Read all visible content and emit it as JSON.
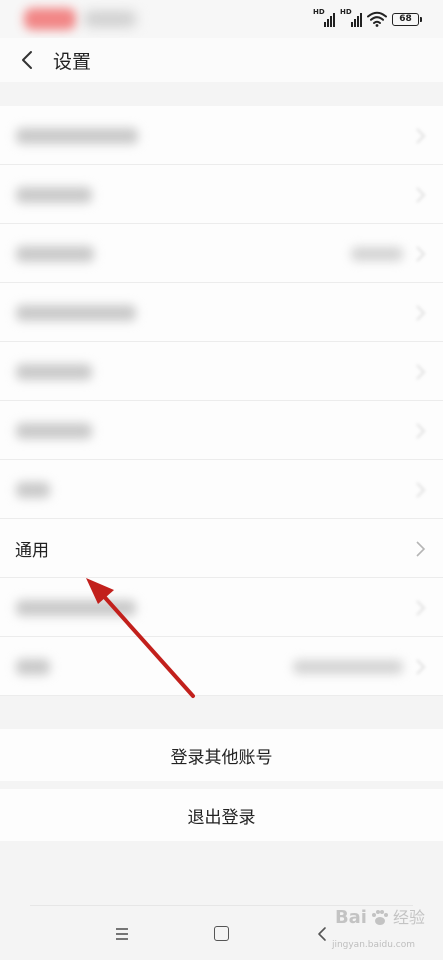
{
  "status_bar": {
    "signal_1_label": "HD",
    "signal_2_label": "HD",
    "battery": "68"
  },
  "header": {
    "title": "设置"
  },
  "settings": {
    "general_label": "通用"
  },
  "actions": {
    "login_other_account": "登录其他账号",
    "logout": "退出登录"
  },
  "watermark": {
    "brand": "Bai",
    "suffix": "经验",
    "url": "jingyan.baidu.com"
  },
  "colors": {
    "annotation_arrow": "#c2201c",
    "background": "#f4f4f4"
  }
}
